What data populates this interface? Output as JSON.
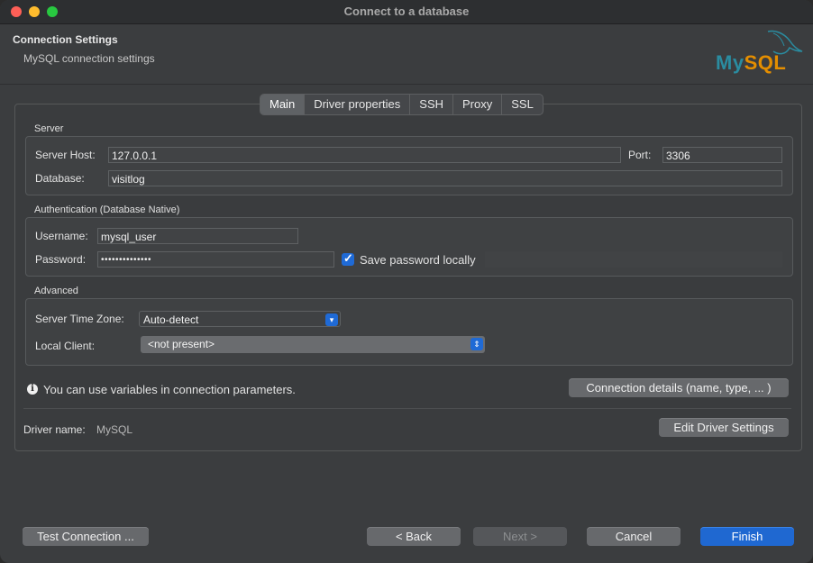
{
  "window": {
    "title": "Connect to a database"
  },
  "header": {
    "title": "Connection Settings",
    "subtitle": "MySQL connection settings",
    "logo_text_my": "My",
    "logo_text_sql": "SQL"
  },
  "tabs": [
    {
      "label": "Main",
      "active": true
    },
    {
      "label": "Driver properties",
      "active": false
    },
    {
      "label": "SSH",
      "active": false
    },
    {
      "label": "Proxy",
      "active": false
    },
    {
      "label": "SSL",
      "active": false
    }
  ],
  "server": {
    "group_label": "Server",
    "host_label": "Server Host:",
    "host_value": "127.0.0.1",
    "port_label": "Port:",
    "port_value": "3306",
    "database_label": "Database:",
    "database_value": "visitlog"
  },
  "auth": {
    "group_label": "Authentication (Database Native)",
    "username_label": "Username:",
    "username_value": "mysql_user",
    "password_label": "Password:",
    "password_value": "••••••••••••••",
    "save_password_label": "Save password locally",
    "save_password_checked": true
  },
  "advanced": {
    "group_label": "Advanced",
    "timezone_label": "Server Time Zone:",
    "timezone_value": "Auto-detect",
    "local_client_label": "Local Client:",
    "local_client_value": "<not present>"
  },
  "info": {
    "text": "You can use variables in connection parameters.",
    "details_button": "Connection details (name, type, ... )"
  },
  "driver": {
    "label": "Driver name:",
    "value": "MySQL",
    "edit_button": "Edit Driver Settings"
  },
  "footer": {
    "test_button": "Test Connection ...",
    "back_button": "< Back",
    "next_button": "Next >",
    "cancel_button": "Cancel",
    "finish_button": "Finish"
  },
  "colors": {
    "accent": "#1f68d1",
    "logo_blue": "#2a8ca0",
    "logo_orange": "#e48e00"
  }
}
